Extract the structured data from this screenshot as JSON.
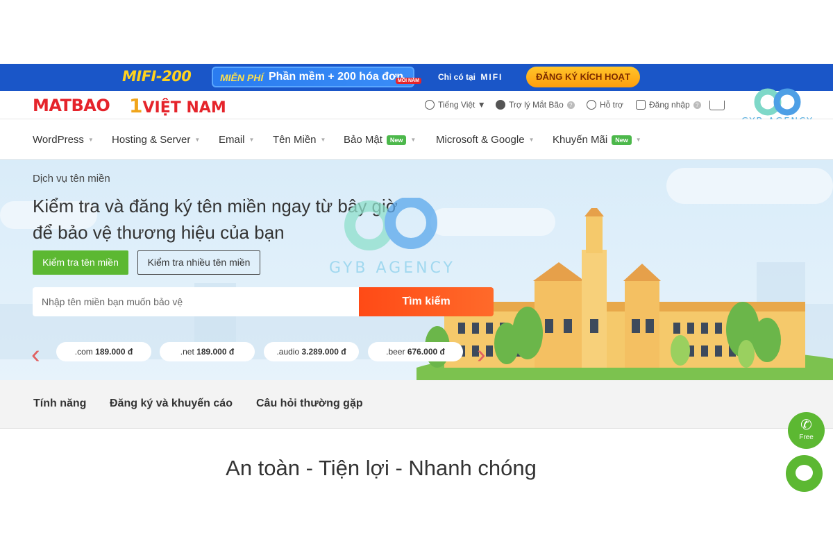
{
  "promo": {
    "brand": "MIFI-200",
    "free": "MIỄN PHÍ",
    "offer": "Phần mềm + 200 hóa đơn",
    "tag": "MỖI NĂM",
    "only_at": "Chỉ có tại",
    "only_brand": "MIFI",
    "cta": "ĐĂNG KÝ KÍCH HOẠT"
  },
  "header": {
    "logo": "MATBAO",
    "logo2_num": "1",
    "logo2_text": "VIỆT NAM",
    "language": "Tiếng Việt ▼",
    "assistant": "Trợ lý Mắt Bão",
    "support": "Hỗ trợ",
    "login": "Đăng nhập",
    "watermark_corner": "GYB AGENCY"
  },
  "nav": {
    "items": [
      {
        "label": "WordPress"
      },
      {
        "label": "Hosting & Server"
      },
      {
        "label": "Email"
      },
      {
        "label": "Tên Miền"
      },
      {
        "label": "Bảo Mật",
        "badge": "New"
      },
      {
        "label": "Microsoft & Google"
      },
      {
        "label": "Khuyến Mãi",
        "badge": "New"
      }
    ]
  },
  "hero": {
    "eyebrow": "Dịch vụ tên miền",
    "headline": "Kiểm tra và đăng ký tên miền ngay từ bây giờ để bảo vệ thương hiệu của bạn",
    "btn_check": "Kiểm tra tên miền",
    "btn_multi": "Kiểm tra nhiều tên miền",
    "search_placeholder": "Nhập tên miền bạn muốn bảo vệ",
    "search_button": "Tìm kiếm",
    "prices": [
      {
        "ext": ".com",
        "price": "189.000 đ"
      },
      {
        "ext": ".net",
        "price": "189.000 đ"
      },
      {
        "ext": ".audio",
        "price": "3.289.000 đ"
      },
      {
        "ext": ".beer",
        "price": "676.000 đ"
      }
    ],
    "watermark": "GYB AGENCY"
  },
  "tabs": [
    "Tính năng",
    "Đăng ký và khuyến cáo",
    "Câu hỏi thường gặp"
  ],
  "tagline": "An toàn - Tiện lợi - Nhanh chóng",
  "fab": {
    "phone_label": "Free"
  },
  "colors": {
    "primary_blue": "#1a56c8",
    "brand_red": "#e5242b",
    "green": "#5cb832",
    "orange": "#ff4a16"
  }
}
